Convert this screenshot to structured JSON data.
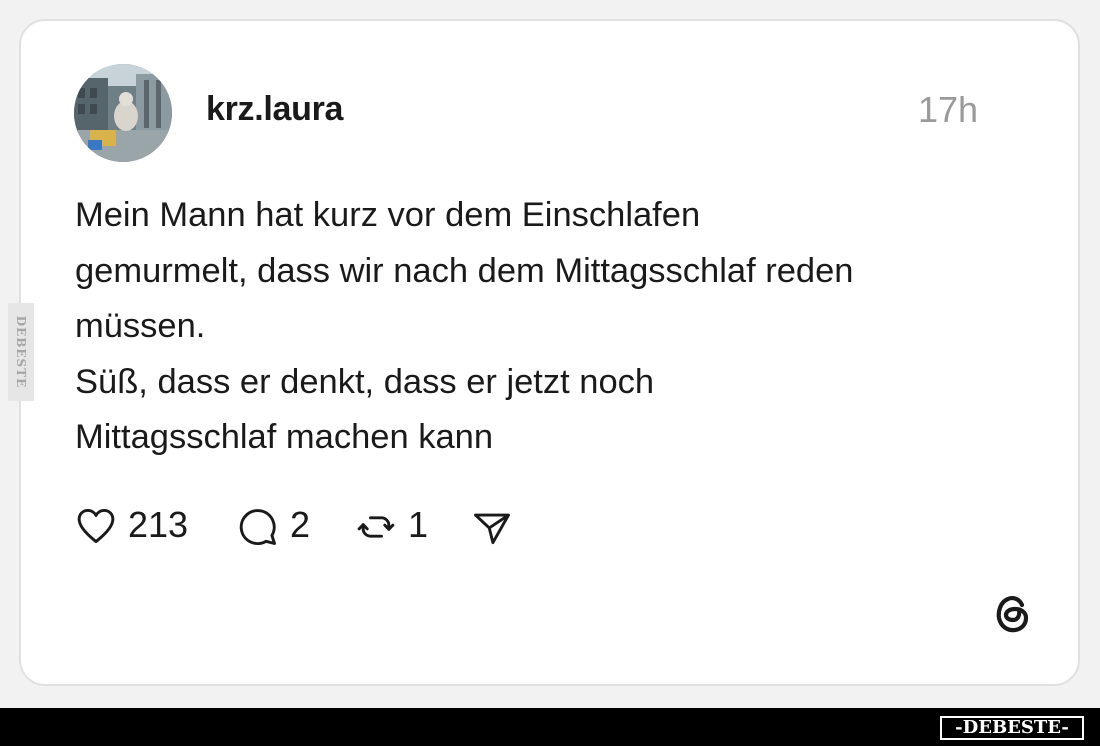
{
  "post": {
    "username": "krz.laura",
    "timestamp": "17h",
    "text_lines": [
      "Mein Mann hat kurz vor dem Einschlafen",
      "gemurmelt, dass wir nach dem Mittagsschlaf reden",
      "müssen.",
      "Süß, dass er denkt, dass er jetzt noch",
      "Mittagsschlaf machen kann"
    ],
    "avatar_icon": "profile-photo"
  },
  "actions": {
    "like": {
      "icon": "heart-icon",
      "count": "213"
    },
    "reply": {
      "icon": "comment-icon",
      "count": "2"
    },
    "repost": {
      "icon": "repost-icon",
      "count": "1"
    },
    "share": {
      "icon": "send-icon"
    }
  },
  "brand": {
    "logo": "threads-logo"
  },
  "watermark": {
    "side_text": "DEBESTE",
    "badge_text": "-DEBESTE-"
  },
  "colors": {
    "text": "#1a1a1a",
    "muted": "#9a9a9a",
    "card_border": "#e0e0e0",
    "background": "#f2f2f2",
    "footer": "#000000"
  }
}
